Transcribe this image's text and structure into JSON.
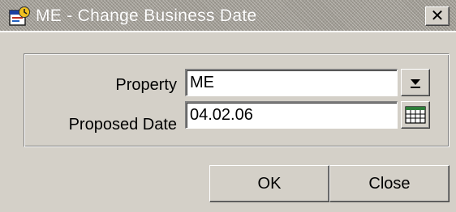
{
  "window": {
    "title": "ME - Change Business Date",
    "app_icon": "app-icon",
    "close_glyph": "✕"
  },
  "form": {
    "property": {
      "label": "Property",
      "value": "ME",
      "dropdown_icon": "dropdown-arrow-icon"
    },
    "proposed_date": {
      "label": "Proposed Date",
      "value": "04.02.06",
      "calendar_icon": "calendar-icon"
    }
  },
  "buttons": {
    "ok_label": "OK",
    "close_label": "Close"
  },
  "colors": {
    "face": "#d4d0c8",
    "field": "#ffffff",
    "title_text": "#ffffff",
    "calendar_green": "#2e7d3a"
  }
}
